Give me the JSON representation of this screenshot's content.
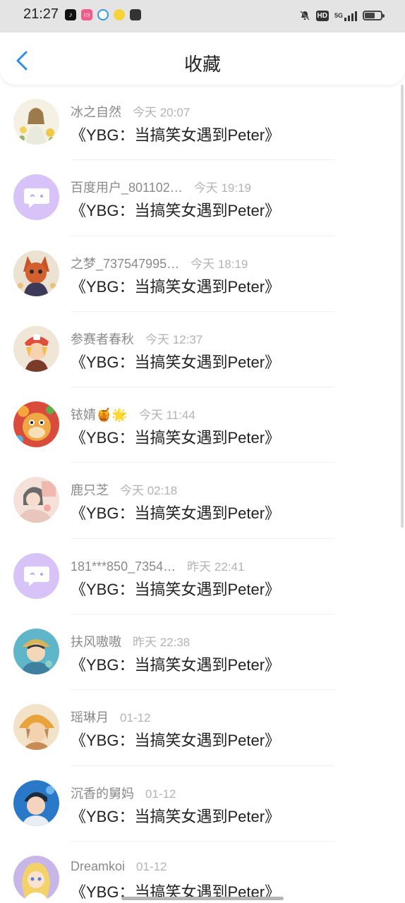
{
  "status_bar": {
    "time": "21:27",
    "network": "5G",
    "hd": "HD"
  },
  "header": {
    "title": "收藏"
  },
  "favorites": [
    {
      "user": "冰之自然",
      "time": "今天  20:07",
      "title": "《YBG：当搞笑女遇到Peter》"
    },
    {
      "user": "百度用户_801102…",
      "time": "今天  19:19",
      "title": "《YBG：当搞笑女遇到Peter》"
    },
    {
      "user": "之梦_737547995…",
      "time": "今天  18:19",
      "title": "《YBG：当搞笑女遇到Peter》"
    },
    {
      "user": "参赛者春秋",
      "time": "今天  12:37",
      "title": "《YBG：当搞笑女遇到Peter》"
    },
    {
      "user": "铱婧🍯🌟",
      "time": "今天  11:44",
      "title": "《YBG：当搞笑女遇到Peter》"
    },
    {
      "user": "鹿只芝",
      "time": "今天  02:18",
      "title": "《YBG：当搞笑女遇到Peter》"
    },
    {
      "user": "181***850_7354…",
      "time": "昨天  22:41",
      "title": "《YBG：当搞笑女遇到Peter》"
    },
    {
      "user": "扶风嗷嗷",
      "time": "昨天  22:38",
      "title": "《YBG：当搞笑女遇到Peter》"
    },
    {
      "user": "瑶琳月",
      "time": "01-12",
      "title": "《YBG：当搞笑女遇到Peter》"
    },
    {
      "user": "沉香的舅妈",
      "time": "01-12",
      "title": "《YBG：当搞笑女遇到Peter》"
    },
    {
      "user": "Dreamkoi",
      "time": "01-12",
      "title": "《YBG：当搞笑女遇到Peter》"
    }
  ],
  "colors": {
    "accent": "#2f8ee6",
    "default_avatar": "#d7c3f7"
  }
}
